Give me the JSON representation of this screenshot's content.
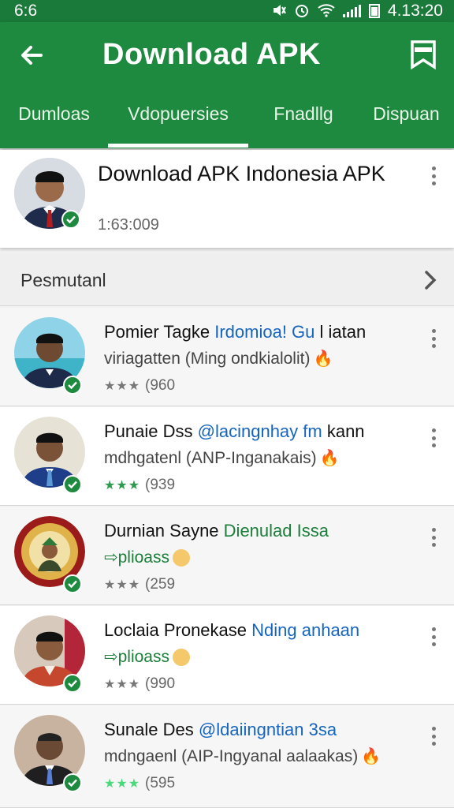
{
  "status_bar": {
    "left_time": "6:6",
    "right_time": "4.13:20",
    "icons": [
      "mute-icon",
      "alarm-icon",
      "wifi-icon",
      "signal-icon",
      "battery-icon"
    ]
  },
  "app_bar": {
    "title": "Download APK",
    "back_icon": "arrow-back-icon",
    "bookmark_icon": "bookmark-icon",
    "color": "#1d8a3f"
  },
  "tabs": [
    {
      "label": "Dumloas"
    },
    {
      "label": "Vdopuersies",
      "selected": true
    },
    {
      "label": "Fnadllg"
    },
    {
      "label": "Dispuan"
    }
  ],
  "header_card": {
    "title": "Download APK Indonesia APK",
    "subtitle": "1:63:009"
  },
  "section": {
    "label": "Pesmutanl"
  },
  "items": [
    {
      "name": "Pomier Tagke",
      "highlight": "Irdomioa! Gu",
      "tail": " l iatan",
      "line2": "viriagatten (Ming ondkialolit)",
      "rating": "(960",
      "stars": "★★★"
    },
    {
      "name": "Punaie Dss",
      "highlight": "@lacingnhay fm",
      "tail": " kann",
      "line2": "mdhgatenl (ANP-Inganakais)",
      "rating": "(939",
      "stars": "★★★"
    },
    {
      "name": "Durnian Sayne",
      "highlight": "Dienulad Issa",
      "tail": "",
      "line2": "⇨plioass",
      "rating": "(259",
      "stars": "★★★"
    },
    {
      "name": "Loclaia Pronekase",
      "highlight": "Nding anhaan",
      "tail": "",
      "line2": "⇨plioass",
      "rating": "(990",
      "stars": "★★★"
    },
    {
      "name": "Sunale Des",
      "highlight": "@ldaiingntian 3sa",
      "tail": "",
      "line2": "mdngaenl (AIP-Ingyanal aalaakas)",
      "rating": "(595",
      "stars": "★★★"
    }
  ]
}
